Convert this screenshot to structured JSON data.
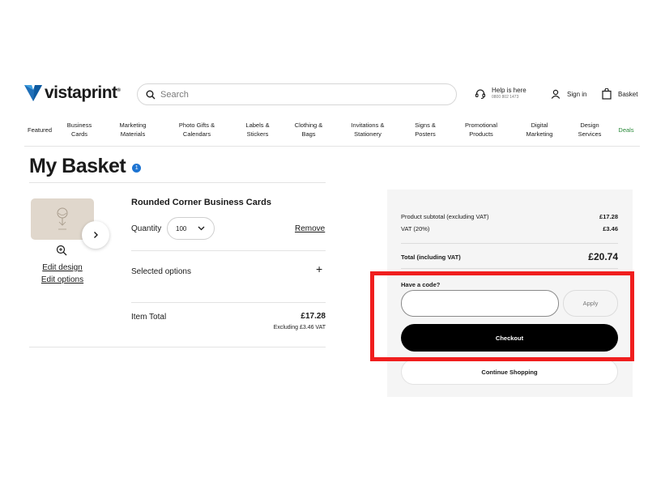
{
  "header": {
    "logo_text": "vistaprint",
    "logo_reg": "®",
    "search_placeholder": "Search",
    "help_title": "Help is here",
    "help_phone": "0800 802 1473",
    "sign_in": "Sign in",
    "basket": "Basket"
  },
  "nav": {
    "items": [
      {
        "line1": "Featured",
        "line2": ""
      },
      {
        "line1": "Business",
        "line2": "Cards"
      },
      {
        "line1": "Marketing",
        "line2": "Materials"
      },
      {
        "line1": "Photo Gifts &",
        "line2": "Calendars"
      },
      {
        "line1": "Labels &",
        "line2": "Stickers"
      },
      {
        "line1": "Clothing &",
        "line2": "Bags"
      },
      {
        "line1": "Invitations &",
        "line2": "Stationery"
      },
      {
        "line1": "Signs &",
        "line2": "Posters"
      },
      {
        "line1": "Promotional",
        "line2": "Products"
      },
      {
        "line1": "Digital",
        "line2": "Marketing"
      },
      {
        "line1": "Design",
        "line2": "Services"
      },
      {
        "line1": "Deals",
        "line2": ""
      }
    ]
  },
  "page": {
    "title": "My Basket",
    "item_count": "1"
  },
  "item": {
    "edit_design": "Edit design",
    "edit_options": "Edit options",
    "name": "Rounded Corner Business Cards",
    "quantity_label": "Quantity",
    "quantity_value": "100",
    "remove": "Remove",
    "selected_options": "Selected options",
    "plus": "+",
    "total_label": "Item Total",
    "total_value": "£17.28",
    "total_vat_note": "Excluding £3.46 VAT"
  },
  "summary": {
    "subtotal_label": "Product subtotal (excluding VAT)",
    "subtotal_value": "£17.28",
    "vat_label": "VAT (20%)",
    "vat_value": "£3.46",
    "total_label": "Total (including VAT)",
    "total_value": "£20.74",
    "code_label": "Have a code?",
    "code_value": "",
    "apply": "Apply",
    "checkout": "Checkout",
    "continue": "Continue Shopping"
  },
  "colors": {
    "accent_blue": "#1d74d2",
    "deals_green": "#2a8a3a",
    "highlight_red": "#f01e1e",
    "checkout_black": "#000000"
  }
}
